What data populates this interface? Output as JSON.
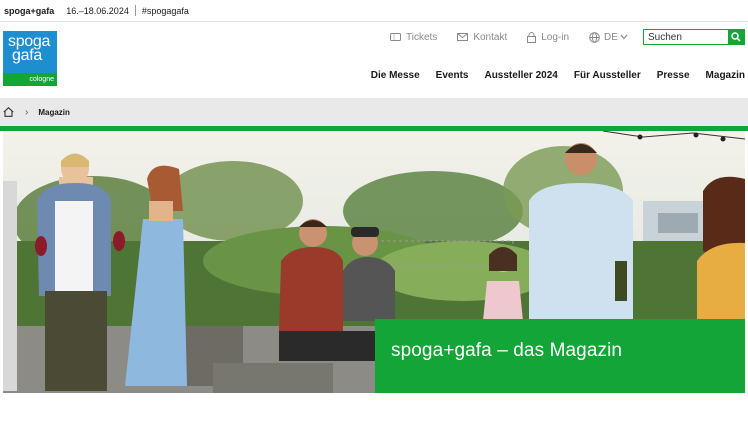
{
  "topbar": {
    "brand": "spoga+gafa",
    "dates": "16.–18.06.2024",
    "hashtag": "#spogagafa"
  },
  "logo": {
    "line1": "spoga",
    "line2": "gafa",
    "city": "cologne"
  },
  "utility": {
    "tickets": "Tickets",
    "contact": "Kontakt",
    "login": "Log-in",
    "language": "DE"
  },
  "search": {
    "placeholder": "Suchen"
  },
  "nav": {
    "items": [
      "Die Messe",
      "Events",
      "Aussteller 2024",
      "Für Aussteller",
      "Presse",
      "Magazin"
    ]
  },
  "breadcrumb": {
    "current": "Magazin"
  },
  "hero": {
    "caption": "spoga+gafa – das Magazin"
  },
  "colors": {
    "brand_green": "#13a538",
    "brand_blue": "#1d8fd0"
  }
}
